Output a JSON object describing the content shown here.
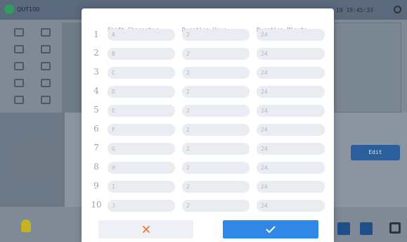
{
  "app": {
    "title": "QUT100",
    "time": "19 19:45:33"
  },
  "background": {
    "edit_label": "Edit"
  },
  "dialog": {
    "headers": [
      "Shift Character",
      "Duration Hour",
      "Duration Minute"
    ],
    "rows": [
      {
        "num": "1",
        "shift": "A",
        "hour": "2",
        "minute": "24"
      },
      {
        "num": "2",
        "shift": "B",
        "hour": "2",
        "minute": "24"
      },
      {
        "num": "3",
        "shift": "C",
        "hour": "2",
        "minute": "24"
      },
      {
        "num": "4",
        "shift": "D",
        "hour": "2",
        "minute": "24"
      },
      {
        "num": "5",
        "shift": "E",
        "hour": "2",
        "minute": "24"
      },
      {
        "num": "6",
        "shift": "F",
        "hour": "2",
        "minute": "24"
      },
      {
        "num": "7",
        "shift": "G",
        "hour": "2",
        "minute": "24"
      },
      {
        "num": "8",
        "shift": "H",
        "hour": "2",
        "minute": "24"
      },
      {
        "num": "9",
        "shift": "I",
        "hour": "2",
        "minute": "24"
      },
      {
        "num": "10",
        "shift": "J",
        "hour": "2",
        "minute": "24"
      }
    ],
    "cancel_icon": "close-icon",
    "confirm_icon": "check-icon",
    "colors": {
      "accent": "#2f88e6",
      "cancel_icon": "#f0783c",
      "field_bg": "#e9edf2"
    }
  }
}
